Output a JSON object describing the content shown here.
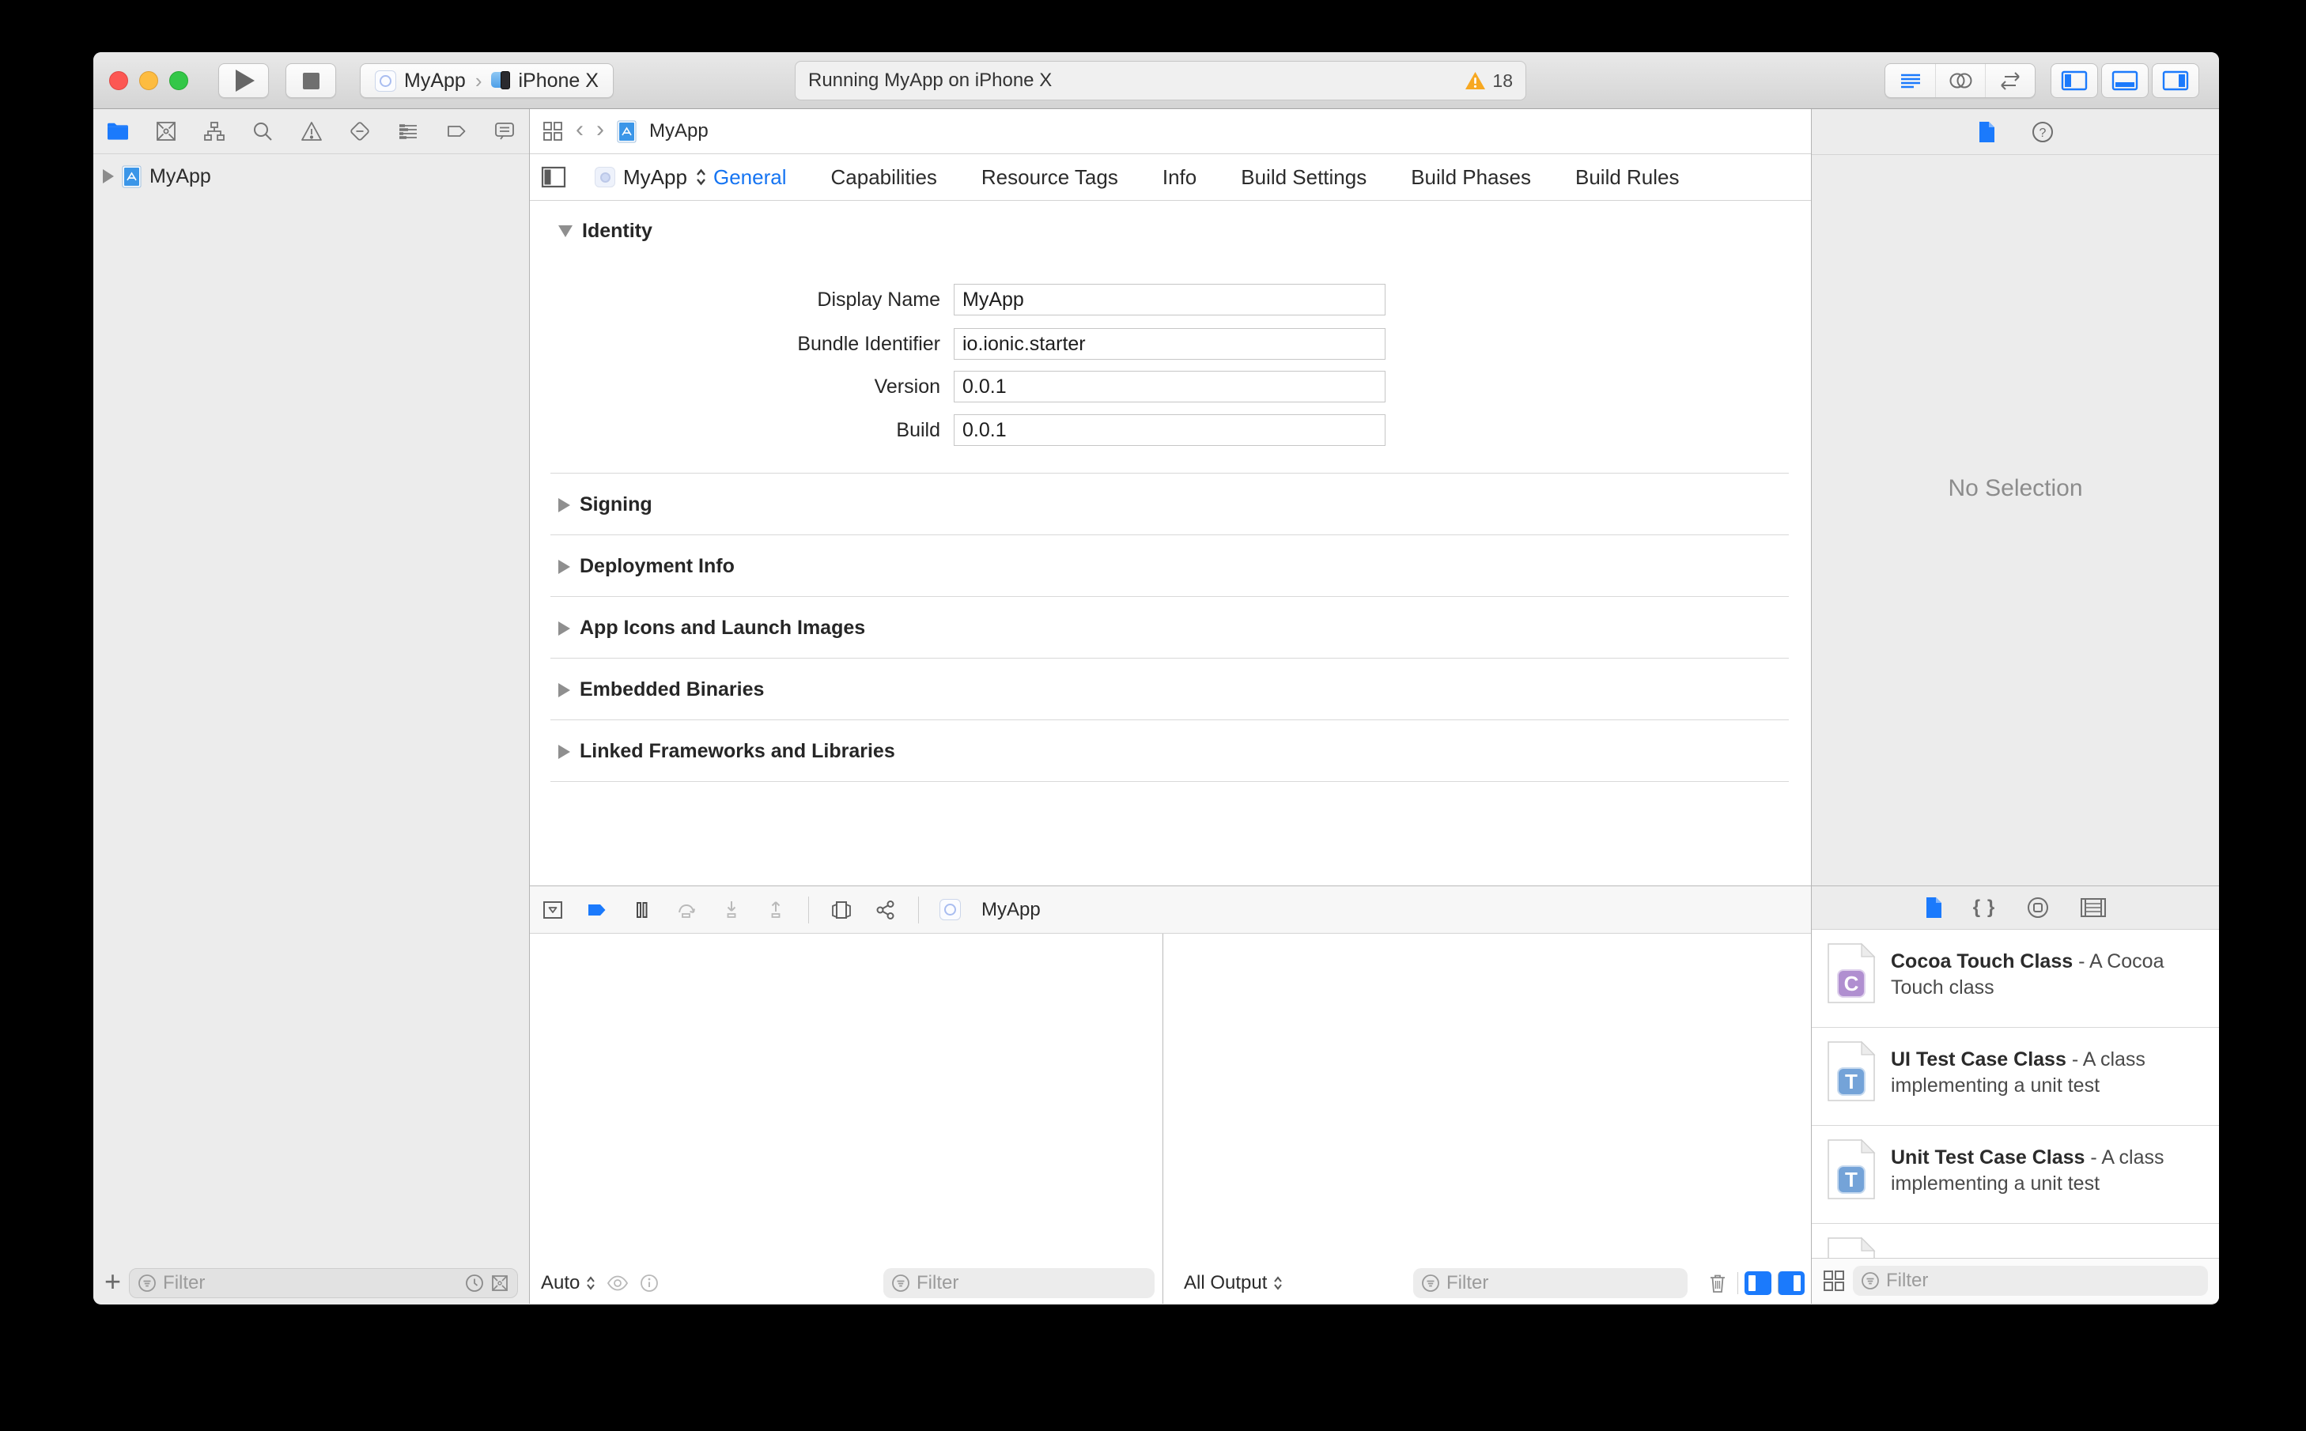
{
  "accent_color": "#1574f2",
  "warning_color": "#f7a821",
  "toolbar": {
    "scheme": "MyApp",
    "destination": "iPhone X",
    "status_text": "Running MyApp on iPhone X",
    "warning_count": "18"
  },
  "navigator": {
    "project_name": "MyApp",
    "filter_placeholder": "Filter"
  },
  "jump_bar": {
    "file_name": "MyApp"
  },
  "editor": {
    "target_name": "MyApp",
    "tabs": [
      "General",
      "Capabilities",
      "Resource Tags",
      "Info",
      "Build Settings",
      "Build Phases",
      "Build Rules"
    ],
    "selected_tab": "General",
    "identity_section": {
      "title": "Identity",
      "fields": [
        {
          "label": "Display Name",
          "value": "MyApp"
        },
        {
          "label": "Bundle Identifier",
          "value": "io.ionic.starter"
        },
        {
          "label": "Version",
          "value": "0.0.1"
        },
        {
          "label": "Build",
          "value": "0.0.1"
        }
      ]
    },
    "collapsed_sections": [
      "Signing",
      "Deployment Info",
      "App Icons and Launch Images",
      "Embedded Binaries",
      "Linked Frameworks and Libraries"
    ]
  },
  "debug_area": {
    "bar_target": "MyApp",
    "variables_scope": "Auto",
    "variables_filter_placeholder": "Filter",
    "console_scope": "All Output",
    "console_filter_placeholder": "Filter"
  },
  "inspector": {
    "empty_message": "No Selection"
  },
  "library": {
    "items": [
      {
        "icon_letter": "C",
        "icon_color": "#b08fd0",
        "title": "Cocoa Touch Class",
        "description": "- A Cocoa Touch class"
      },
      {
        "icon_letter": "T",
        "icon_color": "#74a3d8",
        "title": "UI Test Case Class",
        "description": "- A class implementing a unit test"
      },
      {
        "icon_letter": "T",
        "icon_color": "#74a3d8",
        "title": "Unit Test Case Class",
        "description": "- A class implementing a unit test"
      }
    ],
    "filter_placeholder": "Filter"
  }
}
